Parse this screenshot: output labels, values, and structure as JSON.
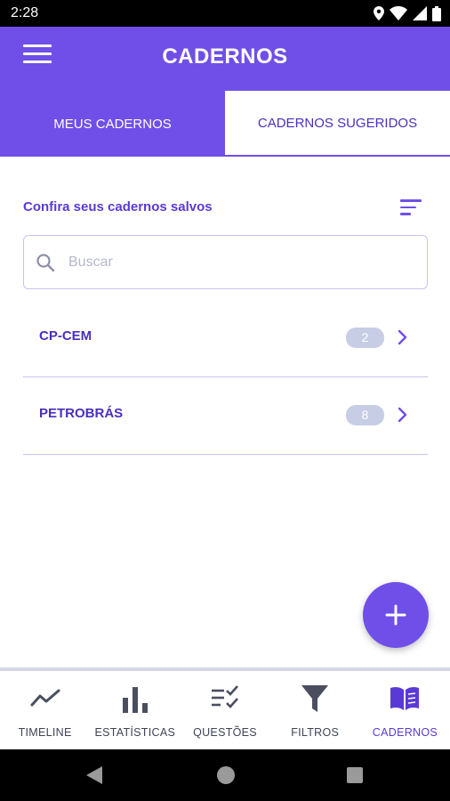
{
  "status_bar": {
    "time": "2:28"
  },
  "app_bar": {
    "title": "CADERNOS"
  },
  "tabs": [
    {
      "label": "MEUS CADERNOS",
      "active": true
    },
    {
      "label": "CADERNOS SUGERIDOS",
      "active": false
    }
  ],
  "section": {
    "label": "Confira seus cadernos salvos"
  },
  "search": {
    "placeholder": "Buscar",
    "value": ""
  },
  "notebooks": [
    {
      "name": "CP-CEM",
      "count": "2"
    },
    {
      "name": "PETROBRÁS",
      "count": "8"
    }
  ],
  "bottom_nav": [
    {
      "label": "TIMELINE",
      "icon": "timeline-icon",
      "active": false
    },
    {
      "label": "ESTATÍSTICAS",
      "icon": "bar-chart-icon",
      "active": false
    },
    {
      "label": "QUESTÕES",
      "icon": "checklist-icon",
      "active": false
    },
    {
      "label": "FILTROS",
      "icon": "filter-icon",
      "active": false
    },
    {
      "label": "CADERNOS",
      "icon": "book-icon",
      "active": true
    }
  ],
  "colors": {
    "primary": "#6f4fe8",
    "text_primary": "#4a2fbf",
    "badge": "#c8cde6",
    "divider": "#c9c2ef"
  }
}
